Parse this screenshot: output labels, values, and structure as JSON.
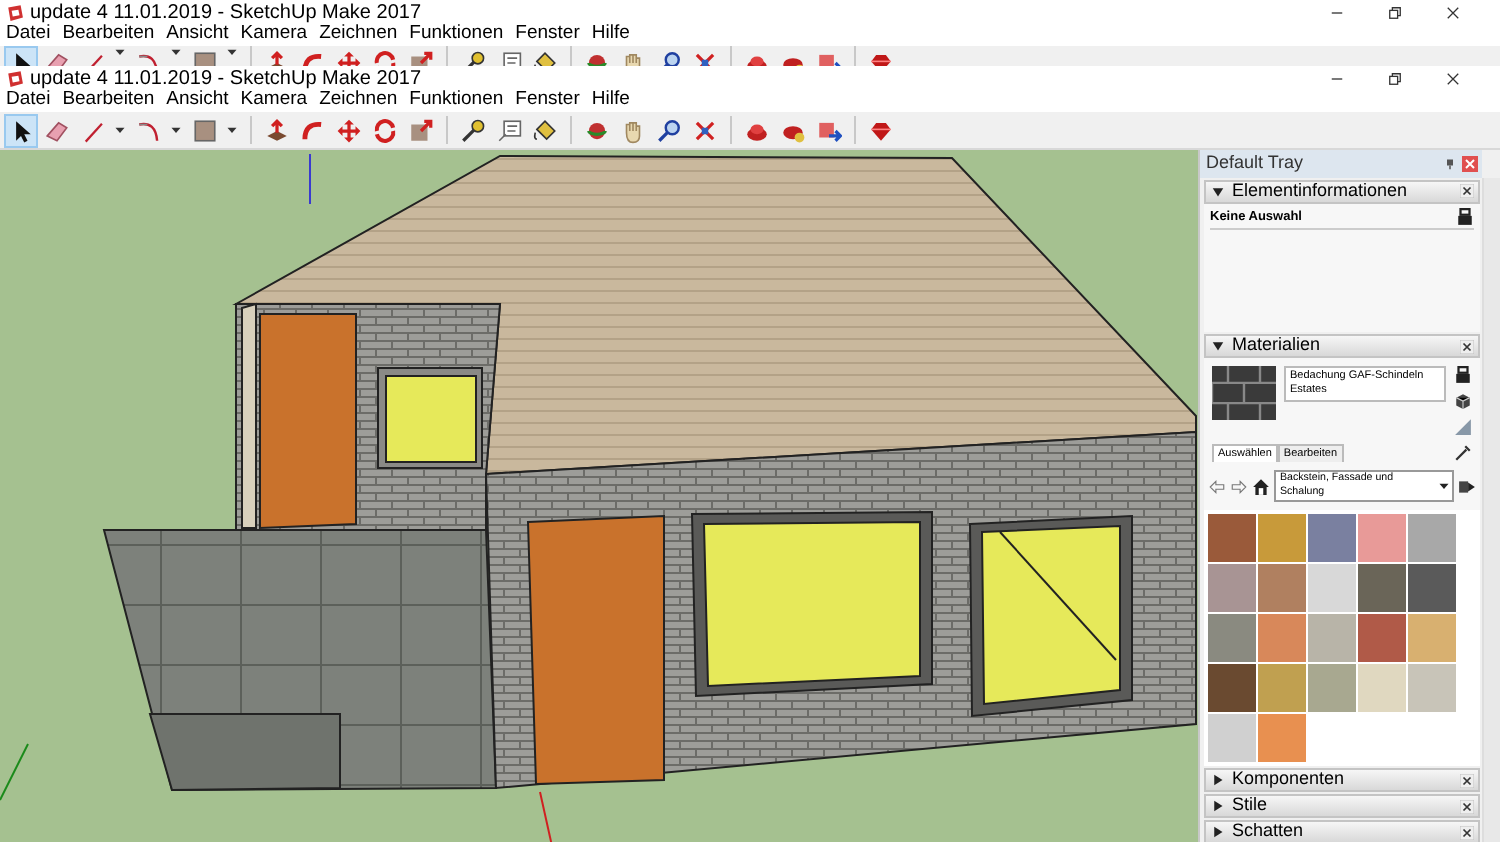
{
  "background_window": {
    "title": "update 4 11.01.2019 - SketchUp Make 2017",
    "menu": [
      "Datei",
      "Bearbeiten",
      "Ansicht",
      "Kamera",
      "Zeichnen",
      "Funktionen",
      "Fenster",
      "Hilfe"
    ],
    "toolbar": [
      {
        "kind": "select",
        "selected": true,
        "dropdown": false
      },
      {
        "kind": "eraser",
        "selected": false,
        "dropdown": false
      },
      {
        "kind": "pencil",
        "selected": false,
        "dropdown": true
      },
      {
        "kind": "arc",
        "selected": false,
        "dropdown": true
      },
      {
        "kind": "rectangle",
        "selected": false,
        "dropdown": true
      },
      {
        "kind": "separator"
      },
      {
        "kind": "pushpull",
        "selected": false,
        "dropdown": false
      },
      {
        "kind": "followme",
        "selected": false,
        "dropdown": false
      },
      {
        "kind": "move",
        "selected": false,
        "dropdown": false
      },
      {
        "kind": "rotate",
        "selected": false,
        "dropdown": false
      },
      {
        "kind": "scale",
        "selected": false,
        "dropdown": false
      },
      {
        "kind": "separator"
      },
      {
        "kind": "tape",
        "selected": false,
        "dropdown": false
      },
      {
        "kind": "text",
        "selected": false,
        "dropdown": false
      },
      {
        "kind": "paint",
        "selected": false,
        "dropdown": false
      },
      {
        "kind": "separator"
      },
      {
        "kind": "orbit",
        "selected": false,
        "dropdown": false
      },
      {
        "kind": "pan",
        "selected": false,
        "dropdown": false
      },
      {
        "kind": "zoom",
        "selected": false,
        "dropdown": false
      },
      {
        "kind": "zoomext",
        "selected": false,
        "dropdown": false
      },
      {
        "kind": "separator"
      },
      {
        "kind": "warehouse",
        "selected": false,
        "dropdown": false
      },
      {
        "kind": "extwarehouse",
        "selected": false,
        "dropdown": false
      },
      {
        "kind": "send",
        "selected": false,
        "dropdown": false
      },
      {
        "kind": "separator"
      },
      {
        "kind": "ruby",
        "selected": false,
        "dropdown": false
      }
    ]
  },
  "window": {
    "title": "update 4 11.01.2019 - SketchUp Make 2017",
    "menu": [
      "Datei",
      "Bearbeiten",
      "Ansicht",
      "Kamera",
      "Zeichnen",
      "Funktionen",
      "Fenster",
      "Hilfe"
    ],
    "toolbar": [
      {
        "kind": "select",
        "selected": true,
        "dropdown": false
      },
      {
        "kind": "eraser",
        "selected": false,
        "dropdown": false
      },
      {
        "kind": "pencil",
        "selected": false,
        "dropdown": true
      },
      {
        "kind": "arc",
        "selected": false,
        "dropdown": true
      },
      {
        "kind": "rectangle",
        "selected": false,
        "dropdown": true
      },
      {
        "kind": "separator"
      },
      {
        "kind": "pushpull",
        "selected": false,
        "dropdown": false
      },
      {
        "kind": "followme",
        "selected": false,
        "dropdown": false
      },
      {
        "kind": "move",
        "selected": false,
        "dropdown": false
      },
      {
        "kind": "rotate",
        "selected": false,
        "dropdown": false
      },
      {
        "kind": "scale",
        "selected": false,
        "dropdown": false
      },
      {
        "kind": "separator"
      },
      {
        "kind": "tape",
        "selected": false,
        "dropdown": false
      },
      {
        "kind": "text",
        "selected": false,
        "dropdown": false
      },
      {
        "kind": "paint",
        "selected": false,
        "dropdown": false
      },
      {
        "kind": "separator"
      },
      {
        "kind": "orbit",
        "selected": false,
        "dropdown": false
      },
      {
        "kind": "pan",
        "selected": false,
        "dropdown": false
      },
      {
        "kind": "zoom",
        "selected": false,
        "dropdown": false
      },
      {
        "kind": "zoomext",
        "selected": false,
        "dropdown": false
      },
      {
        "kind": "separator"
      },
      {
        "kind": "warehouse",
        "selected": false,
        "dropdown": false
      },
      {
        "kind": "extwarehouse",
        "selected": false,
        "dropdown": false
      },
      {
        "kind": "send",
        "selected": false,
        "dropdown": false
      },
      {
        "kind": "separator"
      },
      {
        "kind": "ruby",
        "selected": false,
        "dropdown": false
      }
    ]
  },
  "tray": {
    "title": "Default Tray",
    "panels": [
      {
        "kind": "entity_info",
        "title": "Elementinformationen",
        "expanded": true,
        "selection": "Keine Auswahl"
      },
      {
        "kind": "materials",
        "title": "Materialien",
        "expanded": true,
        "material_name": "Bedachung GAF-Schindeln Estates",
        "tabs": [
          {
            "label": "Auswählen",
            "selected": true
          },
          {
            "label": "Bearbeiten",
            "selected": false
          }
        ],
        "collection": "Backstein, Fassade und Schalung",
        "swatches": [
          {
            "color": "#9a5a3a"
          },
          {
            "color": "#c89a3a"
          },
          {
            "color": "#7a80a0"
          },
          {
            "color": "#e89a98"
          },
          {
            "color": "#a8a8a8"
          },
          {
            "color": "#a89494"
          },
          {
            "color": "#b08060"
          },
          {
            "color": "#d8d8d8"
          },
          {
            "color": "#6a6558"
          },
          {
            "color": "#5a5a5a"
          },
          {
            "color": "#8a8a80"
          },
          {
            "color": "#d8885a"
          },
          {
            "color": "#b8b4a8"
          },
          {
            "color": "#b05a48"
          },
          {
            "color": "#d8b070"
          },
          {
            "color": "#6a4a30"
          },
          {
            "color": "#c0a050"
          },
          {
            "color": "#a8a890"
          },
          {
            "color": "#e0d8c0"
          },
          {
            "color": "#c8c4b8"
          },
          {
            "color": "#d0d0d0"
          },
          {
            "color": "#e89050"
          }
        ]
      },
      {
        "kind": "plain",
        "title": "Komponenten",
        "expanded": false
      },
      {
        "kind": "plain",
        "title": "Stile",
        "expanded": false
      },
      {
        "kind": "plain",
        "title": "Schatten",
        "expanded": false
      }
    ]
  }
}
